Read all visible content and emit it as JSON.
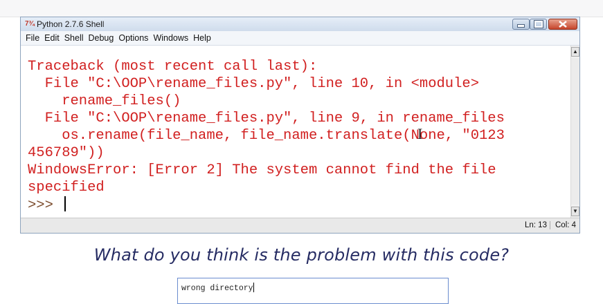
{
  "window": {
    "title": "Python 2.7.6 Shell",
    "icon_label": "7¾",
    "menu": [
      "File",
      "Edit",
      "Shell",
      "Debug",
      "Options",
      "Windows",
      "Help"
    ]
  },
  "shell": {
    "lines": [
      "Traceback (most recent call last):",
      "  File \"C:\\OOP\\rename_files.py\", line 10, in <module>",
      "    rename_files()",
      "  File \"C:\\OOP\\rename_files.py\", line 9, in rename_files",
      "    os.rename(file_name, file_name.translate(None, \"0123",
      "456789\"))",
      "WindowsError: [Error 2] The system cannot find the file",
      "specified"
    ],
    "prompt": ">>> ",
    "text_color": "#d12020"
  },
  "status": {
    "line": "Ln: 13",
    "col": "Col: 4"
  },
  "quiz": {
    "question": "What do you think is the problem with this code?",
    "answer": "wrong directory"
  }
}
